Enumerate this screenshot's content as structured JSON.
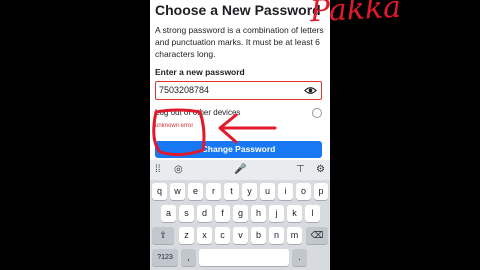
{
  "page": {
    "title": "Choose a New Password",
    "description": "A strong password is a combination of letters and punctuation marks. It must be at least 6 characters long.",
    "password_label": "Enter a new password",
    "password_value": "7503208784",
    "logout_label": "Log out of other devices",
    "error_text": "unknown error",
    "submit_label": "Change Password"
  },
  "keyboard": {
    "row1": [
      "q",
      "w",
      "e",
      "r",
      "t",
      "y",
      "u",
      "i",
      "o",
      "p"
    ],
    "row2": [
      "a",
      "s",
      "d",
      "f",
      "g",
      "h",
      "j",
      "k",
      "l"
    ],
    "row3": [
      "z",
      "x",
      "c",
      "v",
      "b",
      "n",
      "m"
    ],
    "row4": [
      "?123",
      ",",
      "",
      "."
    ]
  },
  "annotation": {
    "text": "Pakka"
  },
  "colors": {
    "accent": "#1877f2",
    "error": "#dd3333",
    "annotation": "#e0192b"
  },
  "icons": [
    "eye-icon",
    "toolbar-grid-icon",
    "globe-icon",
    "microphone-icon",
    "shirt-icon",
    "settings-icon",
    "backspace-icon",
    "shift-icon"
  ]
}
